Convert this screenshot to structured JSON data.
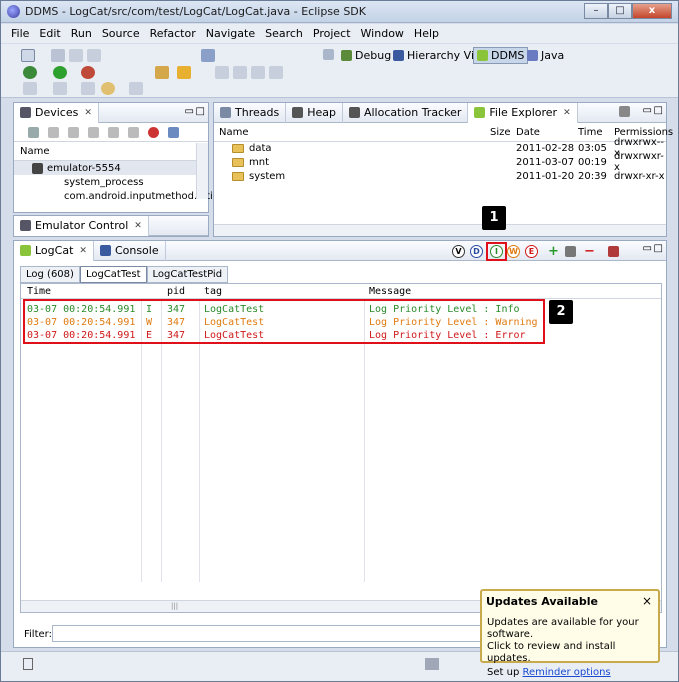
{
  "window": {
    "title": "DDMS - LogCat/src/com/test/LogCat/LogCat.java - Eclipse SDK",
    "min": "–",
    "max": "□",
    "close": "x"
  },
  "menu": [
    "File",
    "Edit",
    "Run",
    "Source",
    "Refactor",
    "Navigate",
    "Search",
    "Project",
    "Window",
    "Help"
  ],
  "perspectives": {
    "debug": "Debug",
    "hierarchy": "Hierarchy Vi...",
    "ddms": "DDMS",
    "java": "Java"
  },
  "devices": {
    "tab": "Devices",
    "col_name": "Name",
    "items": [
      "emulator-5554",
      "system_process",
      "com.android.inputmethod.latin"
    ]
  },
  "emulator_control": {
    "tab": "Emulator Control"
  },
  "file_explorer": {
    "tabs": [
      "Threads",
      "Heap",
      "Allocation Tracker",
      "File Explorer"
    ],
    "columns": [
      "Name",
      "Size",
      "Date",
      "Time",
      "Permissions"
    ],
    "rows": [
      {
        "name": "data",
        "date": "2011-02-28",
        "time": "03:05",
        "perm": "drwxrwx--x"
      },
      {
        "name": "mnt",
        "date": "2011-03-07",
        "time": "00:19",
        "perm": "drwxrwxr-x"
      },
      {
        "name": "system",
        "date": "2011-01-20",
        "time": "20:39",
        "perm": "drwxr-xr-x"
      }
    ]
  },
  "logcat": {
    "tabs": [
      "LogCat",
      "Console"
    ],
    "subtabs": [
      "Log (608)",
      "LogCatTest",
      "LogCatTestPid"
    ],
    "level_buttons": [
      "V",
      "D",
      "I",
      "W",
      "E"
    ],
    "columns": [
      "Time",
      "pid",
      "tag",
      "Message"
    ],
    "rows": [
      {
        "time": "03-07 00:20:54.991",
        "level": "I",
        "pid": "347",
        "tag": "LogCatTest",
        "msg": "Log Priority Level : Info"
      },
      {
        "time": "03-07 00:20:54.991",
        "level": "W",
        "pid": "347",
        "tag": "LogCatTest",
        "msg": "Log Priority Level : Warning"
      },
      {
        "time": "03-07 00:20:54.991",
        "level": "E",
        "pid": "347",
        "tag": "LogCatTest",
        "msg": "Log Priority Level : Error"
      }
    ],
    "filter_label": "Filter:"
  },
  "callouts": {
    "one": "1",
    "two": "2"
  },
  "popup": {
    "title": "Updates Available",
    "close": "×",
    "line1": "Updates are available for your software.",
    "line2": "Click to review and install updates.",
    "line3_prefix": "Set up",
    "link": "Reminder options"
  },
  "colors": {
    "info": "#2a8a2a",
    "warn": "#e07a10",
    "error": "#d01818",
    "callout_border": "#e0101a"
  }
}
